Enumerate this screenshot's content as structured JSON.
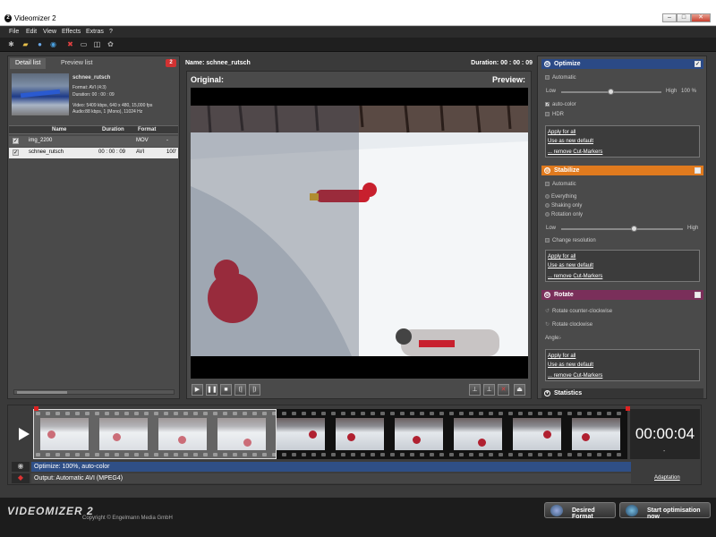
{
  "window": {
    "title": "Videomizer 2",
    "min": "–",
    "max": "□",
    "close": "✕"
  },
  "menu": [
    "File",
    "Edit",
    "View",
    "Effects",
    "Extras",
    "?"
  ],
  "left_panel": {
    "tabs": {
      "detail": "Detail list",
      "preview": "Preview list"
    },
    "badge": "2",
    "file_info": {
      "name": "schnee_rutsch",
      "format": "Format: AVI (4:3)",
      "duration": "Duration: 00 : 00 : 09",
      "video": "Video: 5409 kbps, 640 x 480, 15,000 fps",
      "audio": "Audio:88 kbps, 1 (Mono), 11024 Hz"
    },
    "columns": {
      "name": "Name",
      "duration": "Duration",
      "format": "Format"
    },
    "rows": [
      {
        "check": "✓",
        "name": "img_2200",
        "duration": "",
        "format": "MOV",
        "extra": "-"
      },
      {
        "check": "✓",
        "name": "schnee_rutsch",
        "duration": "00 : 00 : 09",
        "format": "AVI",
        "extra": "100'"
      }
    ]
  },
  "center": {
    "name": "Name: schnee_rutsch",
    "duration": "Duration: 00 : 00 : 09",
    "original_label": "Original:",
    "preview_label": "Preview:"
  },
  "right_panel": {
    "optimize": {
      "title": "Optimize",
      "checked": "✓",
      "automatic": "Automatic",
      "low": "Low",
      "high": "High",
      "percent": "100 %",
      "auto_color": "auto-color",
      "hdr": "HDR",
      "apply_all": "Apply for all",
      "use_default": "Use as new default",
      "remove_markers": "... remove Cut-Markers",
      "slider_value": 0.5,
      "color": "#2b4a86"
    },
    "stabilize": {
      "title": "Stabilize",
      "automatic": "Automatic",
      "everything": "Everything",
      "shaking": "Shaking only",
      "rotation": "Rotation only",
      "low": "Low",
      "high": "High",
      "change_res": "Change resolution",
      "apply_all": "Apply for all",
      "use_default": "Use as new default",
      "remove_markers": "... remove Cut-Markers",
      "slider_value": 0.6,
      "color": "#e07a1e"
    },
    "rotate": {
      "title": "Rotate",
      "ccw": "Rotate counter-clockwise",
      "cw": "Rotate clockwise",
      "angle": "Angle:",
      "angle_value": "-",
      "apply_all": "Apply for all",
      "use_default": "Use as new default",
      "remove_markers": "... remove Cut-Markers",
      "color": "#7a2f5a"
    },
    "statistics": {
      "title": "Statistics"
    }
  },
  "timeline": {
    "timecode": "00:00:04",
    "dash": "-",
    "optimize_row": "Optimize: 100%, auto-color",
    "output_row": "Output: Automatic AVI (MPEG4)",
    "adaptation": "Adaptation",
    "selection_fraction": 0.41
  },
  "bottom": {
    "logo": "VIDEOMIZER 2",
    "copyright": "Copyright © Engelmann Media GmbH",
    "desired_format": "Desired Format",
    "start": "Start optimisation now"
  }
}
